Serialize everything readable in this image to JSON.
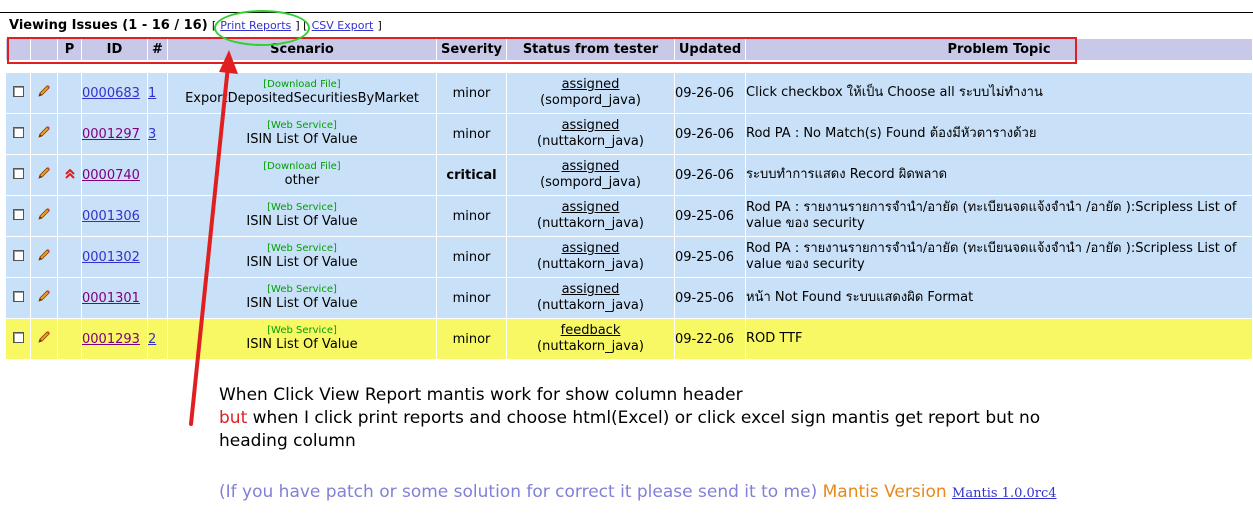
{
  "header": {
    "title": "Viewing Issues (1 - 16 / 16)",
    "bracket_open": "[",
    "print_reports": "Print Reports",
    "separator": "] [",
    "csv_export": "CSV Export",
    "bracket_close": "]"
  },
  "columns": [
    "",
    "",
    "P",
    "ID",
    "#",
    "Scenario",
    "Severity",
    "Status from tester",
    "Updated",
    "Problem Topic"
  ],
  "rows": [
    {
      "id": "0000683",
      "visited": false,
      "notes": "1",
      "priority": "",
      "category": "[Download File]",
      "scenario": "ExportDepositedSecuritiesByMarket",
      "severity": "minor",
      "status": "assigned",
      "handler": "(sompord_java)",
      "updated": "09-26-06",
      "topic": "Click checkbox ให้เป็น Choose all ระบบไม่ทำงาน",
      "color": "blue"
    },
    {
      "id": "0001297",
      "visited": true,
      "notes": "3",
      "priority": "",
      "category": "[Web Service]",
      "scenario": "ISIN List Of Value",
      "severity": "minor",
      "status": "assigned",
      "handler": "(nuttakorn_java)",
      "updated": "09-26-06",
      "topic": "Rod PA : No Match(s) Found ต้องมีหัวตารางด้วย",
      "color": "blue"
    },
    {
      "id": "0000740",
      "visited": true,
      "notes": "",
      "priority": "high",
      "category": "[Download File]",
      "scenario": "other",
      "severity": "critical",
      "status": "assigned",
      "handler": "(sompord_java)",
      "updated": "09-26-06",
      "topic": "ระบบทำการแสดง Record ผิดพลาด",
      "color": "blue"
    },
    {
      "id": "0001306",
      "visited": false,
      "notes": "",
      "priority": "",
      "category": "[Web Service]",
      "scenario": "ISIN List Of Value",
      "severity": "minor",
      "status": "assigned",
      "handler": "(nuttakorn_java)",
      "updated": "09-25-06",
      "topic": "Rod PA : รายงานรายการจำนำ/อายัด (ทะเบียนจดแจ้งจำนำ /อายัด ):Scripless List of value ของ security",
      "color": "blue"
    },
    {
      "id": "0001302",
      "visited": false,
      "notes": "",
      "priority": "",
      "category": "[Web Service]",
      "scenario": "ISIN List Of Value",
      "severity": "minor",
      "status": "assigned",
      "handler": "(nuttakorn_java)",
      "updated": "09-25-06",
      "topic": "Rod PA : รายงานรายการจำนำ/อายัด (ทะเบียนจดแจ้งจำนำ /อายัด ):Scripless List of value ของ security",
      "color": "blue"
    },
    {
      "id": "0001301",
      "visited": true,
      "notes": "",
      "priority": "",
      "category": "[Web Service]",
      "scenario": "ISIN List Of Value",
      "severity": "minor",
      "status": "assigned",
      "handler": "(nuttakorn_java)",
      "updated": "09-25-06",
      "topic": "หน้า Not Found ระบบแสดงผิด Format",
      "color": "blue"
    },
    {
      "id": "0001293",
      "visited": true,
      "notes": "2",
      "priority": "",
      "category": "[Web Service]",
      "scenario": "ISIN List Of Value",
      "severity": "minor",
      "status": "feedback",
      "handler": "(nuttakorn_java)",
      "updated": "09-22-06",
      "topic": "ROD TTF",
      "color": "yellow"
    }
  ],
  "annotation": {
    "line1": "When Click View Report mantis work for show column header",
    "line2_red": "but",
    "line2_rest": " when I click print reports and choose html(Excel) or click excel sign mantis get report but no",
    "line3": "heading column",
    "footer_purple": "(If you have patch or some solution for correct it please send it to me)",
    "footer_orange": "Mantis Version",
    "footer_link": "Mantis 1.0.0rc4"
  },
  "colors": {
    "header_bg": "#c8c8e8",
    "row_blue": "#c8e0f8",
    "row_yellow": "#f8f864",
    "annotation_red": "#e02020",
    "annotation_green": "#30d030"
  }
}
